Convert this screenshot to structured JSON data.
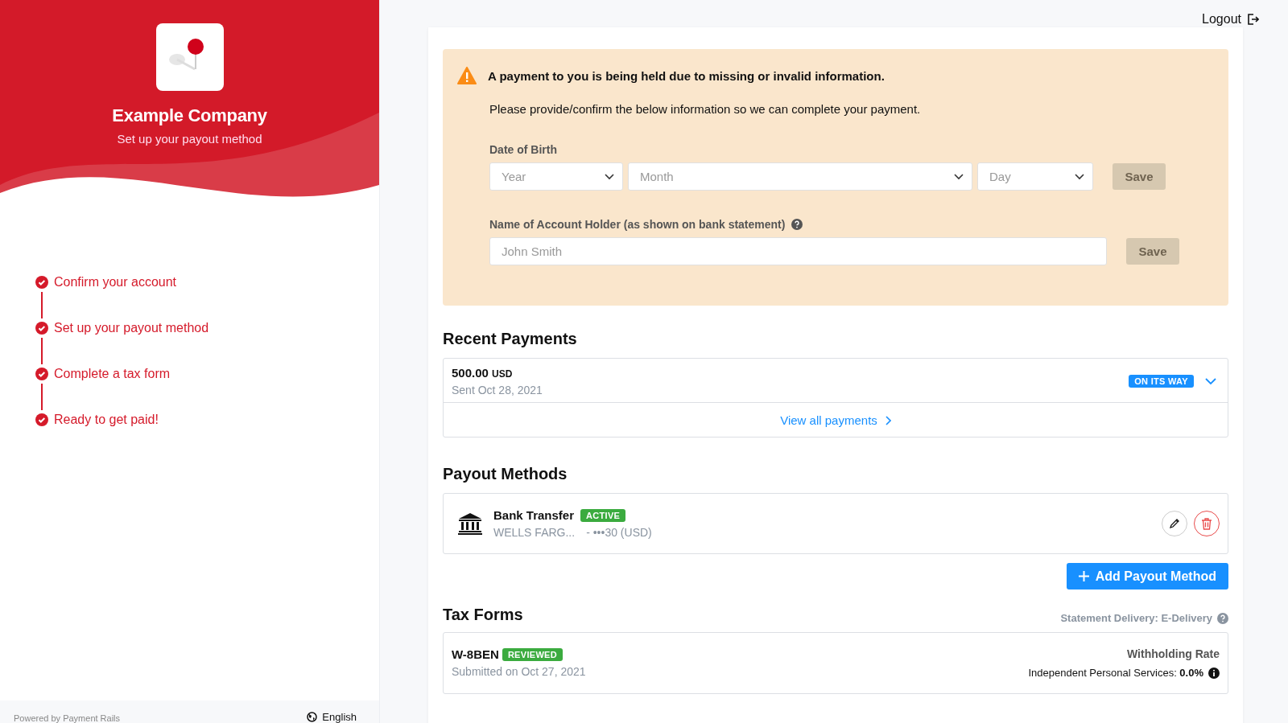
{
  "sidebar": {
    "company_name": "Example Company",
    "subtitle": "Set up your payout method",
    "steps": [
      {
        "label": "Confirm your account",
        "done": true
      },
      {
        "label": "Set up your payout method",
        "done": true
      },
      {
        "label": "Complete a tax form",
        "done": true
      },
      {
        "label": "Ready to get paid!",
        "done": true
      }
    ],
    "footer": {
      "powered_by": "Powered by Payment Rails",
      "language": "English"
    }
  },
  "logout": "Logout",
  "alert": {
    "title": "A payment to you is being held due to missing or invalid information.",
    "message": "Please provide/confirm the below information so we can complete your payment.",
    "date_of_birth": {
      "label": "Date of Birth",
      "selects": [
        {
          "placeholder": "Year"
        },
        {
          "placeholder": "Month"
        },
        {
          "placeholder": "Day"
        }
      ],
      "save": {
        "label": "Save",
        "disabled": true
      }
    },
    "account_holder": {
      "label": "Name of Account Holder (as shown on bank statement)",
      "placeholder": "John Smith",
      "save": {
        "label": "Save",
        "disabled": true
      }
    }
  },
  "recent_payments": {
    "title": "Recent Payments",
    "payments": [
      {
        "amount": "500.00",
        "currency": "USD",
        "date": "Sent Oct 28, 2021",
        "status": "ON ITS WAY",
        "color": "#1890ff"
      }
    ],
    "view_all": "View all payments"
  },
  "payout_methods": {
    "title": "Payout Methods",
    "methods": [
      {
        "name": "Bank Transfer",
        "status": "ACTIVE",
        "color": "#3bab3f",
        "bank": "WELLS FARG...",
        "account": "- •••30 (USD)"
      }
    ],
    "add_button": "Add Payout Method"
  },
  "tax_forms": {
    "title": "Tax Forms",
    "delivery": "Statement Delivery: E-Delivery",
    "forms": [
      {
        "name": "W-8BEN",
        "status": "REVIEWED",
        "color": "#3bab3f",
        "submitted": "Submitted on Oct 27, 2021",
        "rate_label": "Withholding Rate",
        "rate_text": "Independent Personal Services:",
        "rate_value": "0.0%"
      }
    ]
  }
}
